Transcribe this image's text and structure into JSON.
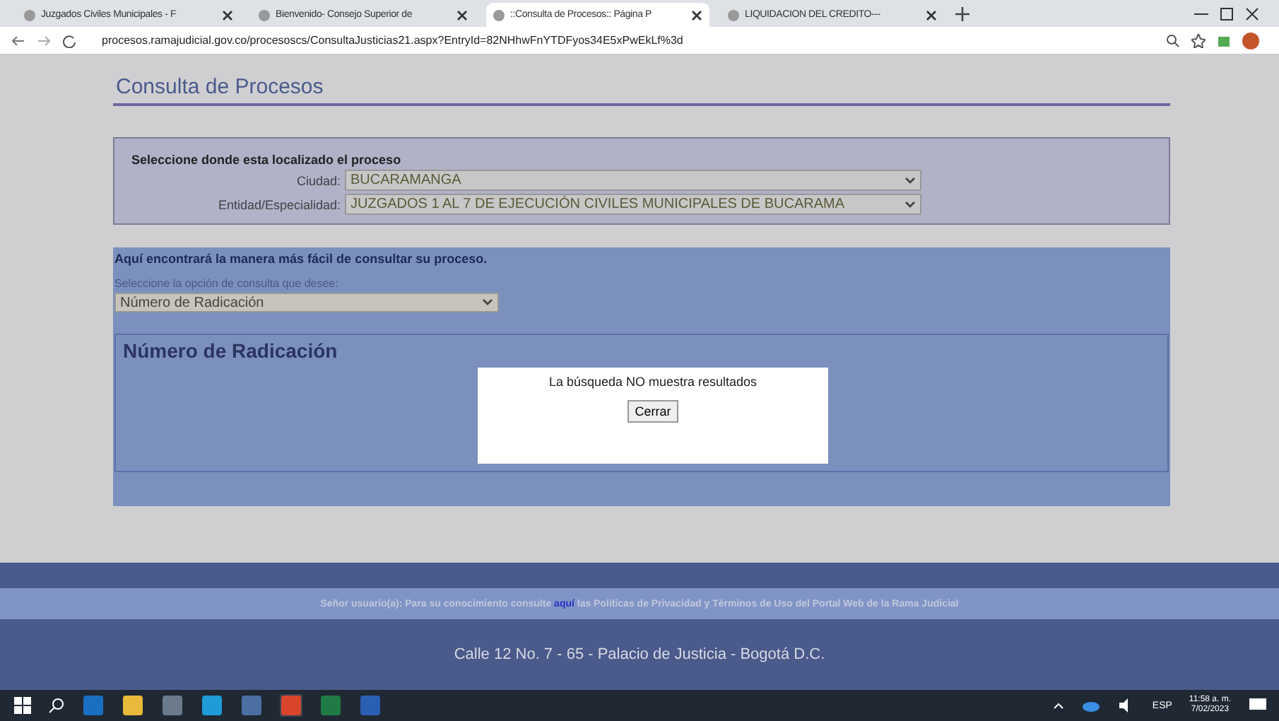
{
  "browser": {
    "tabs": [
      {
        "title": "Juzgados Civiles Municipales - F",
        "selected": false
      },
      {
        "title": "Bienvenido- Consejo Superior de",
        "selected": false
      },
      {
        "title": "::Consulta de Procesos:: Página P",
        "selected": true
      },
      {
        "title": "LIQUIDACION DEL CREDITO---",
        "selected": false
      }
    ],
    "url": "procesos.ramajudicial.gov.co/procesoscs/ConsultaJusticias21.aspx?EntryId=82NHhwFnYTDFyos34E5xPwEkLf%3d"
  },
  "page": {
    "title": "Consulta de Procesos",
    "location": {
      "heading": "Seleccione donde esta localizado el proceso",
      "fields": [
        {
          "label": "Ciudad:",
          "value": "BUCARAMANGA"
        },
        {
          "label": "Entidad/Especialidad:",
          "value": "JUZGADOS 1 AL 7 DE EJECUCIÓN CIVILES MUNICIPALES DE BUCARAMA"
        }
      ]
    },
    "query": {
      "intro": "Aquí encontrará la manera más fácil de consultar su proceso.",
      "prompt": "Seleccione la opción de consulta que desee:",
      "option": "Número de Radicación",
      "section_title": "Número de Radicación"
    },
    "dialog": {
      "message": "La búsqueda NO muestra resultados",
      "button": "Cerrar"
    },
    "notice": {
      "before": "Señor usuario(a): Para su conocimiento consulte",
      "link": "aquí",
      "after": "las Políticas de Privacidad y Términos de Uso del Portal Web de la Rama Judicial"
    },
    "address": "Calle 12 No. 7 - 65 - Palacio de Justicia - Bogotá D.C."
  },
  "taskbar": {
    "language": "ESP",
    "time": "11:58 a. m.",
    "date": "7/02/2023"
  }
}
